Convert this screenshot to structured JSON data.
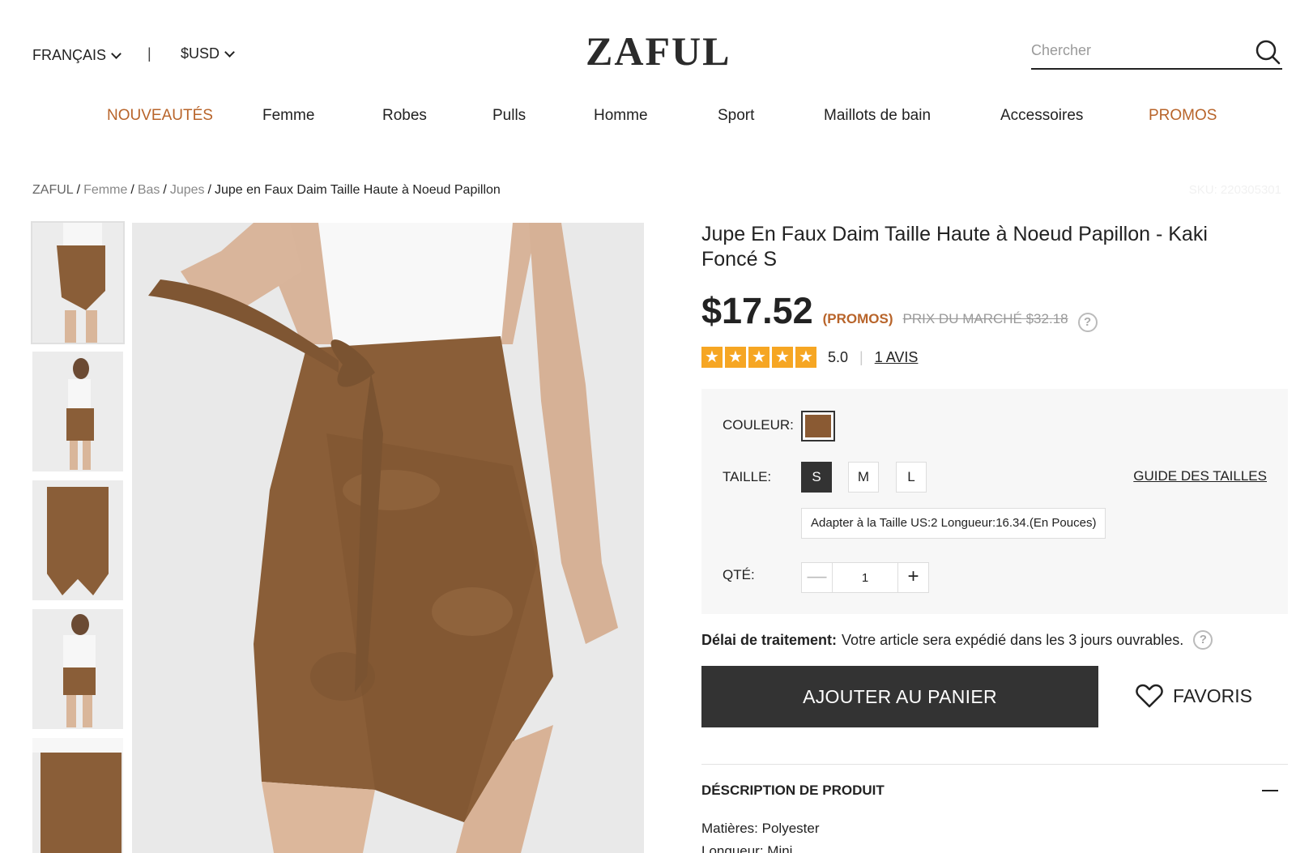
{
  "header": {
    "language": "FRANÇAIS",
    "separator": "|",
    "currency": "$USD",
    "logo": "ZAFUL",
    "search_placeholder": "Chercher"
  },
  "nav": {
    "items": [
      {
        "label": "NOUVEAUTÉS",
        "accent": true
      },
      {
        "label": "Femme",
        "accent": false
      },
      {
        "label": "Robes",
        "accent": false
      },
      {
        "label": "Pulls",
        "accent": false
      },
      {
        "label": "Homme",
        "accent": false
      },
      {
        "label": "Sport",
        "accent": false
      },
      {
        "label": "Maillots de bain",
        "accent": false
      },
      {
        "label": "Accessoires",
        "accent": false
      },
      {
        "label": "PROMOS",
        "accent": true
      }
    ]
  },
  "breadcrumb": {
    "items": [
      "ZAFUL",
      "Femme",
      "Bas",
      "Jupes"
    ],
    "current": "Jupe en Faux Daim Taille Haute à Noeud Papillon",
    "sku": "SKU: 220305301"
  },
  "product": {
    "title": "Jupe En Faux Daim Taille Haute à Noeud Papillon - Kaki Foncé S",
    "price": "$17.52",
    "promo_label": "(PROMOS)",
    "market_price": "PRIX DU MARCHÉ $32.18",
    "rating_score": "5.0",
    "rating_stars": 5,
    "reviews_label": "1 AVIS",
    "color_label": "COULEUR:",
    "size_label": "TAILLE:",
    "sizes": [
      "S",
      "M",
      "L"
    ],
    "selected_size": "S",
    "size_guide": "GUIDE DES TAILLES",
    "size_info": "Adapter à la Taille US:2    Longueur:16.34.(En Pouces)",
    "qty_label": "QTÉ:",
    "qty_value": "1",
    "delay_label": "Délai de traitement:",
    "delay_text": "Votre article sera expédié dans les 3 jours ouvrables.",
    "add_to_cart": "AJOUTER AU PANIER",
    "favorites": "FAVORIS",
    "description_title": "DÉSCRIPTION DE PRODUIT",
    "description_lines": [
      "Matières: Polyester",
      "Longueur: Mini"
    ]
  },
  "colors": {
    "accent": "#b8642a",
    "dark": "#333333",
    "star": "#f6a623",
    "swatch": "#8a5a33"
  }
}
